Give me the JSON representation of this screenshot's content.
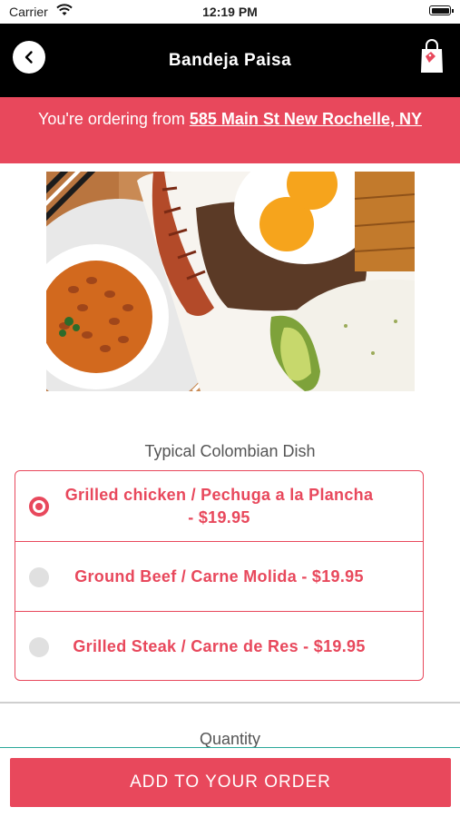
{
  "status_bar": {
    "carrier": "Carrier",
    "time": "12:19 PM"
  },
  "header": {
    "title": "Bandeja Paisa",
    "back_icon": "chevron-left-icon",
    "cart_icon": "shopping-bag-icon"
  },
  "banner": {
    "prefix": "You're ordering from ",
    "address": "585 Main St New Rochelle, NY"
  },
  "section": {
    "label": "Typical Colombian Dish"
  },
  "options": [
    {
      "label": "Grilled chicken / Pechuga a la Plancha - $19.95",
      "selected": true
    },
    {
      "label": "Ground Beef / Carne Molida - $19.95",
      "selected": false
    },
    {
      "label": "Grilled Steak / Carne de Res - $19.95",
      "selected": false
    }
  ],
  "quantity": {
    "label": "Quantity"
  },
  "footer": {
    "add_button_label": "ADD TO YOUR ORDER"
  },
  "colors": {
    "accent": "#e8485c",
    "navbar": "#000000",
    "radio_unselected": "#e0e0e0"
  }
}
